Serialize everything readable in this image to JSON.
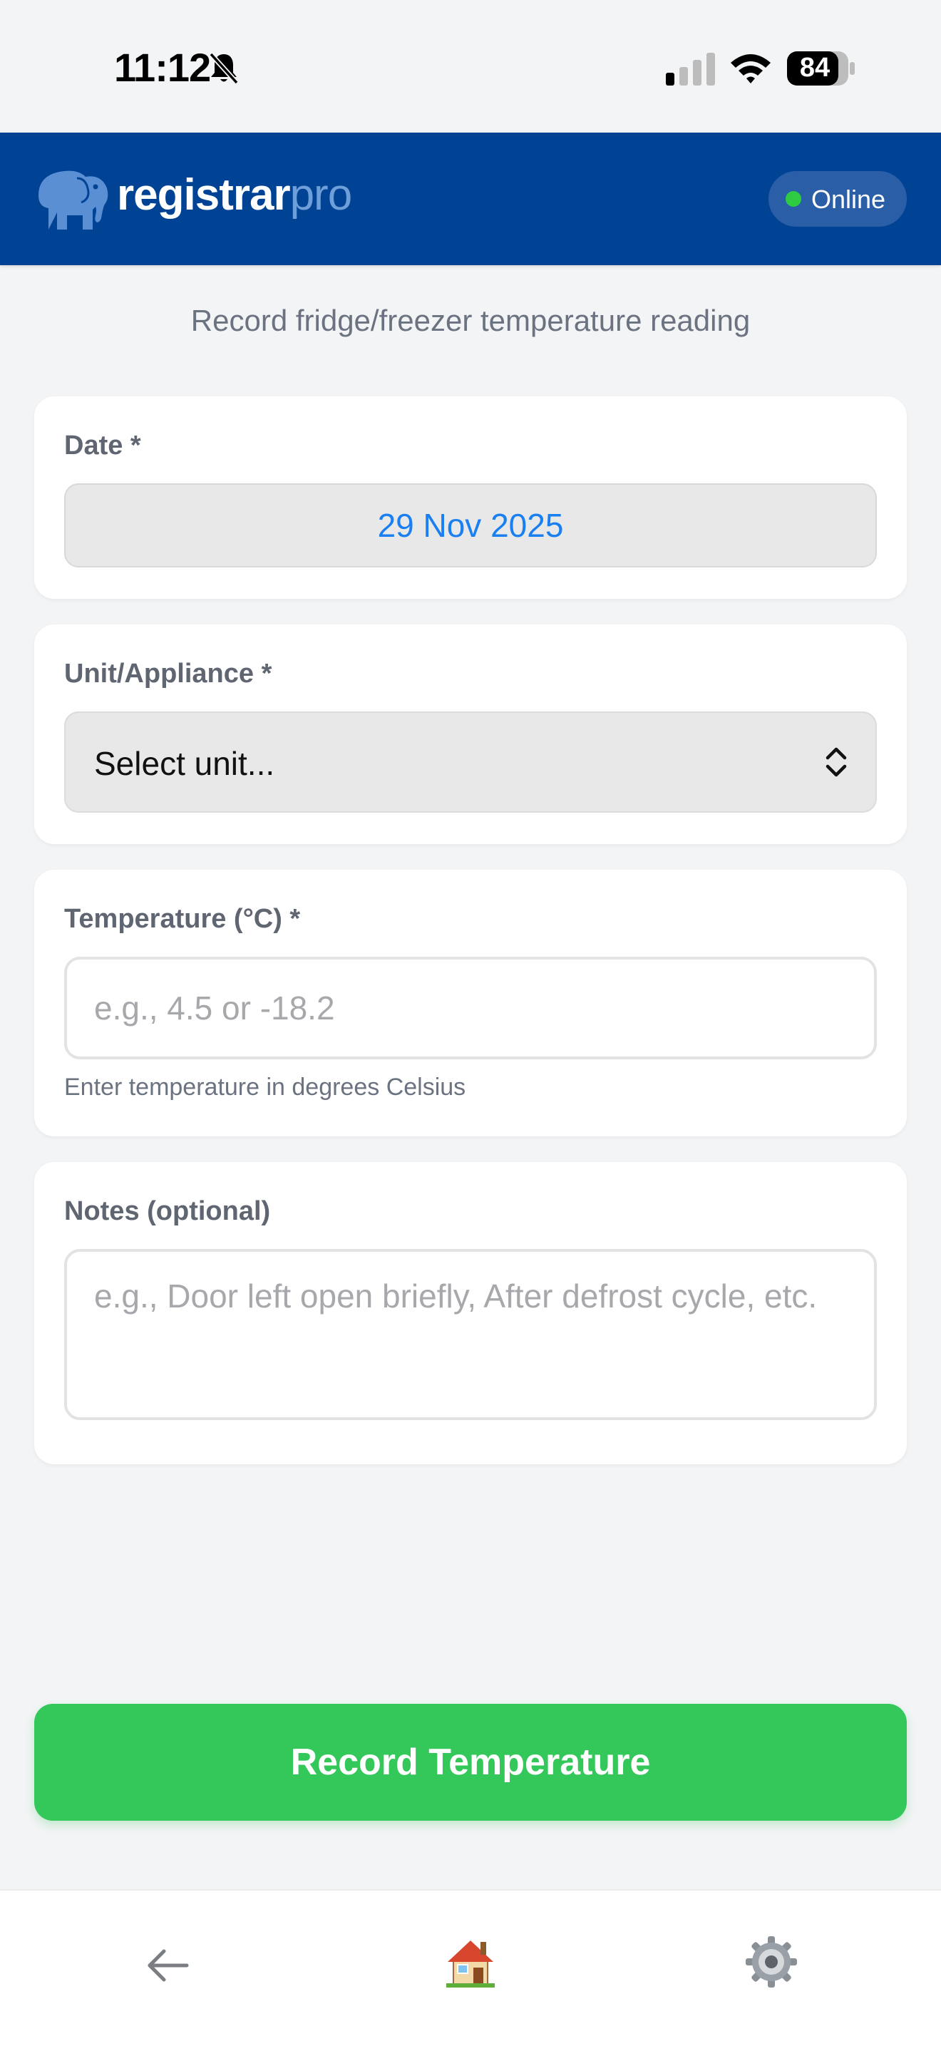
{
  "status_bar": {
    "time": "11:12",
    "battery": "84",
    "icons": [
      "bell-slash-icon",
      "signal-icon",
      "wifi-icon",
      "battery-icon"
    ]
  },
  "header": {
    "brand_primary": "registrar",
    "brand_secondary": "pro",
    "logo_icon": "elephant-icon",
    "connection_status": "Online",
    "colors": {
      "background": "#004395",
      "status_dot": "#2ecc40"
    }
  },
  "page": {
    "subtitle": "Record fridge/freezer temperature reading"
  },
  "form": {
    "date": {
      "label": "Date *",
      "value": "29 Nov 2025"
    },
    "unit": {
      "label": "Unit/Appliance *",
      "selected": "Select unit..."
    },
    "temperature": {
      "label": "Temperature (°C) *",
      "placeholder": "e.g., 4.5 or -18.2",
      "helper": "Enter temperature in degrees Celsius"
    },
    "notes": {
      "label": "Notes (optional)",
      "placeholder": "e.g., Door left open briefly, After defrost cycle, etc."
    }
  },
  "actions": {
    "submit_label": "Record Temperature",
    "colors": {
      "submit": "#34c759"
    }
  },
  "bottom_nav": {
    "items": [
      {
        "name": "back",
        "icon": "arrow-left-icon"
      },
      {
        "name": "home",
        "icon": "house-icon"
      },
      {
        "name": "settings",
        "icon": "gear-icon"
      }
    ]
  }
}
